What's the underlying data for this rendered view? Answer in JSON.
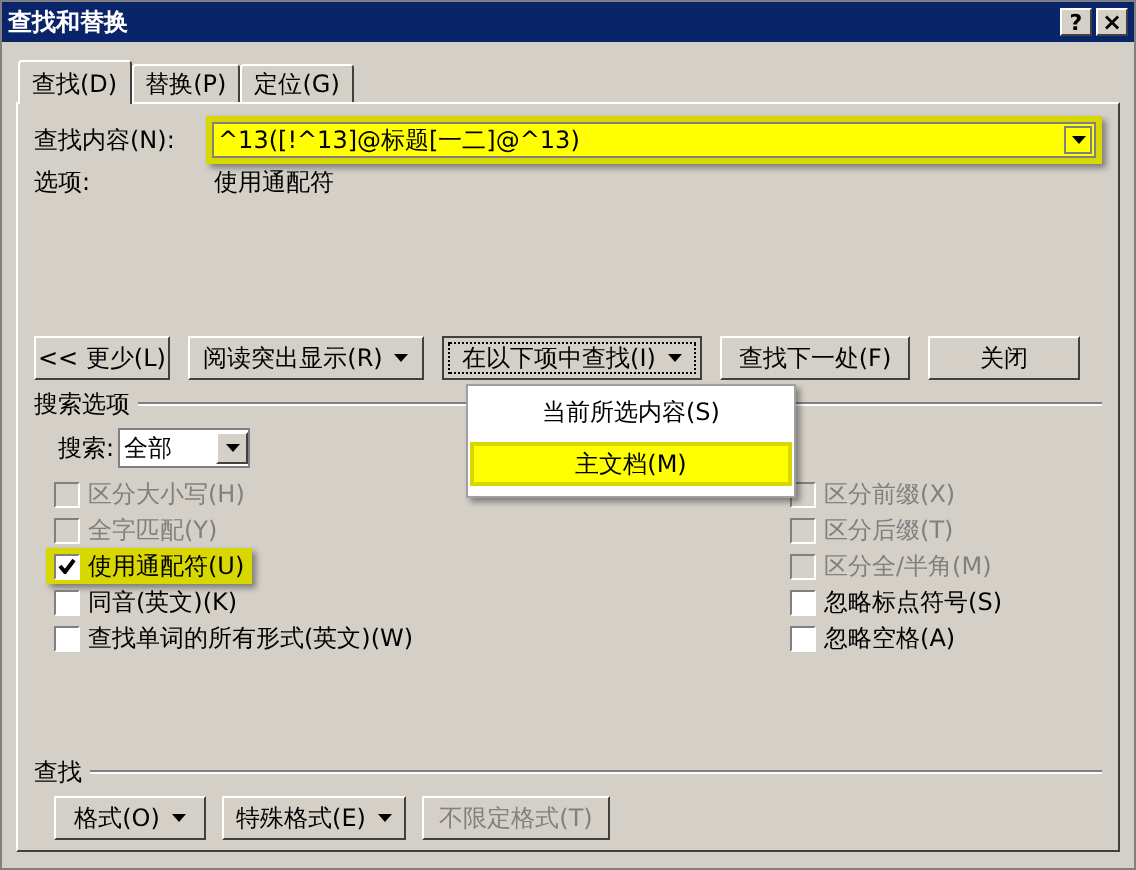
{
  "window": {
    "title": "查找和替换",
    "help_button": "?",
    "close_button": "×"
  },
  "tabs": [
    {
      "label": "查找(D)",
      "selected": true
    },
    {
      "label": "替换(P)",
      "selected": false
    },
    {
      "label": "定位(G)",
      "selected": false
    }
  ],
  "find_what": {
    "label": "查找内容(N):",
    "value": "^13([!^13]@标题[一二]@^13)",
    "highlighted": true
  },
  "options": {
    "label": "选项:",
    "value": "使用通配符"
  },
  "buttons": [
    {
      "label": "<< 更少(L)",
      "dropdown": false,
      "pressed": false
    },
    {
      "label": "阅读突出显示(R)",
      "dropdown": true,
      "pressed": false
    },
    {
      "label": "在以下项中查找(I)",
      "dropdown": true,
      "pressed": true
    },
    {
      "label": "查找下一处(F)",
      "dropdown": false,
      "pressed": false
    },
    {
      "label": "关闭",
      "dropdown": false,
      "pressed": false
    }
  ],
  "find_in_menu": [
    {
      "label": "当前所选内容(S)",
      "highlighted": false
    },
    {
      "label": "主文档(M)",
      "highlighted": true
    }
  ],
  "search_options": {
    "title": "搜索选项",
    "search_label": "搜索:",
    "search_value": "全部"
  },
  "left_checks": [
    {
      "label": "区分大小写(H)",
      "checked": false,
      "disabled": true,
      "highlighted": false
    },
    {
      "label": "全字匹配(Y)",
      "checked": false,
      "disabled": true,
      "highlighted": false
    },
    {
      "label": "使用通配符(U)",
      "checked": true,
      "disabled": false,
      "highlighted": true
    },
    {
      "label": "同音(英文)(K)",
      "checked": false,
      "disabled": false,
      "highlighted": false
    },
    {
      "label": "查找单词的所有形式(英文)(W)",
      "checked": false,
      "disabled": false,
      "highlighted": false
    }
  ],
  "right_checks": [
    {
      "label": "区分前缀(X)",
      "checked": false,
      "disabled": true,
      "highlighted": false
    },
    {
      "label": "区分后缀(T)",
      "checked": false,
      "disabled": true,
      "highlighted": false
    },
    {
      "label": "区分全/半角(M)",
      "checked": false,
      "disabled": true,
      "highlighted": false
    },
    {
      "label": "忽略标点符号(S)",
      "checked": false,
      "disabled": false,
      "highlighted": false
    },
    {
      "label": "忽略空格(A)",
      "checked": false,
      "disabled": false,
      "highlighted": false
    }
  ],
  "find_section": {
    "title": "查找"
  },
  "format_buttons": [
    {
      "label": "格式(O)",
      "dropdown": true,
      "disabled": false
    },
    {
      "label": "特殊格式(E)",
      "dropdown": true,
      "disabled": false
    },
    {
      "label": "不限定格式(T)",
      "dropdown": false,
      "disabled": true
    }
  ]
}
